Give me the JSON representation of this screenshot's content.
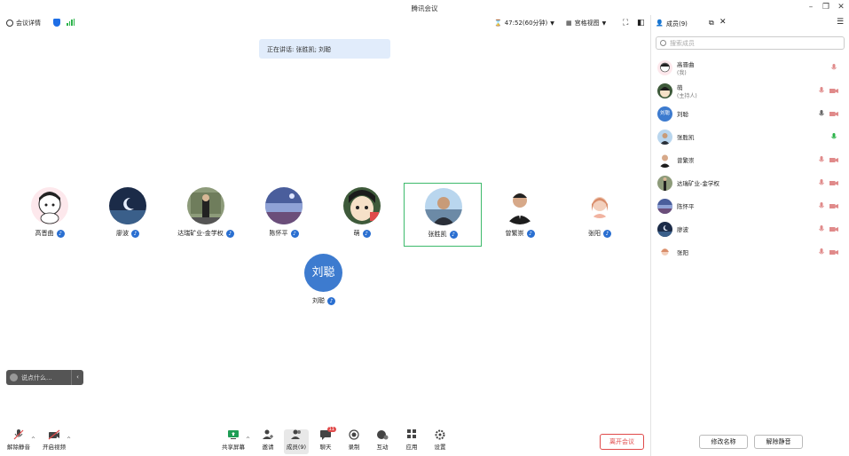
{
  "window": {
    "title": "腾讯会议"
  },
  "toolbar": {
    "meeting_info": "会议详情",
    "timer": "47:52(60分钟)",
    "view": "宫格视图"
  },
  "speaking": "正在讲话: 张胜凯; 刘聪",
  "tiles": [
    {
      "name": "高晋曲"
    },
    {
      "name": "廖波"
    },
    {
      "name": "达瑞矿业-金学权"
    },
    {
      "name": "陈怀平"
    },
    {
      "name": "萌"
    },
    {
      "name": "张胜凯"
    },
    {
      "name": "曾繁崇"
    },
    {
      "name": "张阳"
    }
  ],
  "big": {
    "initials": "刘聪",
    "name": "刘聪"
  },
  "chat": {
    "placeholder": "说点什么..."
  },
  "bottom": {
    "unmute": "解除静音",
    "video": "开启视频",
    "share": "共享屏幕",
    "invite": "邀请",
    "members": "成员(9)",
    "chat": "聊天",
    "chat_badge": "11",
    "record": "录制",
    "interact": "互动",
    "apps": "应用",
    "settings": "设置",
    "leave": "离开会议"
  },
  "panel": {
    "title": "成员(9)",
    "search_placeholder": "搜索成员",
    "members": [
      {
        "name": "高晋曲",
        "role": "(我)"
      },
      {
        "name": "萌",
        "role": "(主持人)"
      },
      {
        "name": "刘聪",
        "initials": "刘聪"
      },
      {
        "name": "张胜凯"
      },
      {
        "name": "曾繁崇"
      },
      {
        "name": "达瑞矿业-金学权"
      },
      {
        "name": "陈怀平"
      },
      {
        "name": "廖波"
      },
      {
        "name": "张阳"
      }
    ],
    "rename": "修改名称",
    "unmute": "解除静音"
  },
  "colors": {
    "accent": "#2a6fd1",
    "speaking_bg": "#e1ecfb",
    "active_border": "#3dba6b",
    "leave": "#e04a4a",
    "mic_on": "#2bb34a",
    "muted": "#e08a8a"
  }
}
